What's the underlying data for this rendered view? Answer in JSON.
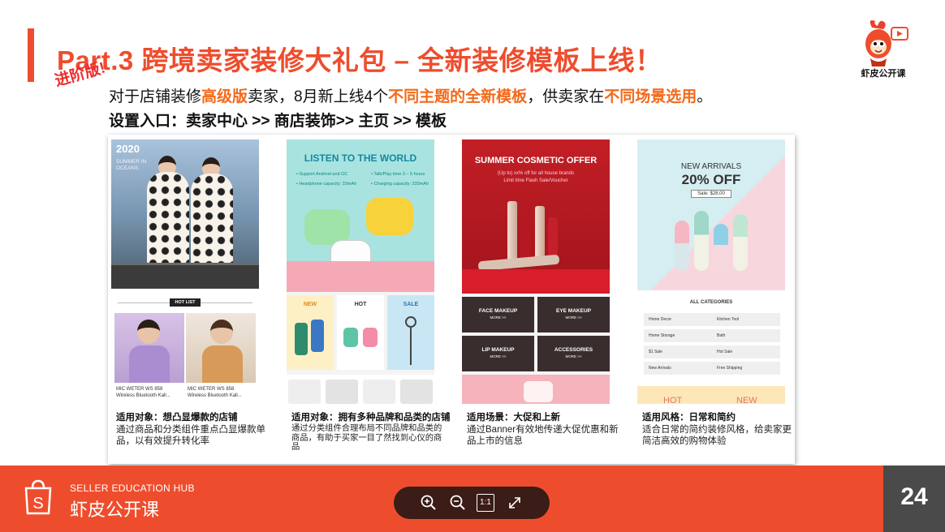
{
  "slide": {
    "title": "Part.3 跨境卖家装修大礼包 – 全新装修模板上线！",
    "stamp": "进阶版!",
    "intro": {
      "p1": "对于店铺装修",
      "h1": "高级版",
      "p2": "卖家，8月新上线4个",
      "h2": "不同主题的全新模板",
      "p3": "，供卖家在",
      "h3": "不同场景选用",
      "p4": "。"
    },
    "entry": "设置入口：卖家中心 >> 商店装饰>> 主页 >> 模板",
    "logo_label": "虾皮公开课"
  },
  "templates": [
    {
      "caption_title": "适用对象：想凸显爆款的店铺",
      "caption_desc": "通过商品和分类组件重点凸显爆款单品，以有效提升转化率",
      "shot": {
        "year": "2020",
        "subtitle": "SUMMER IN OCEANS",
        "hot_list": "HOT LIST",
        "item1": "MIC WETER WS 858\nWireless Bluetooth Kall...",
        "item2": "MIC WETER WS 858\nWireless Bluetooth Kall..."
      }
    },
    {
      "caption_title": "适用对象：拥有多种品牌和品类的店铺",
      "caption_desc": "通过分类组件合理布局不同品牌和品类的商品，有助于买家一目了然找到心仪的商品",
      "shot": {
        "heading": "LISTEN TO THE WORLD",
        "spec1": "• Support Android and OC",
        "spec2": "• Talk/Play time 3 – 5 hours",
        "spec3": "• Headphone capacity: 33mAh",
        "spec4": "• Charging capacity: 333mAh",
        "tile1": "NEW",
        "tile2": "HOT",
        "tile3": "SALE"
      }
    },
    {
      "caption_title": "适用场景：大促和上新",
      "caption_desc": "通过Banner有效地传递大促优惠和新品上市的信息",
      "shot": {
        "heading": "SUMMER COSMETIC OFFER",
        "sub1": "(Up to) xx% off for all house brands",
        "sub2": "Limit time Flash Sale/Voucher",
        "cell1": "FACE MAKEUP",
        "cell2": "EYE MAKEUP",
        "cell3": "LIP MAKEUP",
        "cell4": "ACCESSORIES",
        "more": "MORE >>"
      }
    },
    {
      "caption_title": "适用风格：日常和简约",
      "caption_desc": "适合日常的简约装修风格，给卖家更简洁高效的购物体验",
      "shot": {
        "t1": "NEW ARRIVALS",
        "t2": "20% OFF",
        "t3": "Sale: $28,00",
        "categories": "ALL CATEGORIES",
        "rows": [
          "Home Decor",
          "Kitchen Tool",
          "Home Storage",
          "Bath",
          "$1 Sale",
          "Hot Sale",
          "New Arrivals",
          "Free Shipping"
        ],
        "hot": "HOT",
        "new": "NEW"
      }
    }
  ],
  "footer": {
    "hub_en": "SELLER EDUCATION HUB",
    "hub_cn": "虾皮公开课",
    "page_number": "24",
    "toolbar": {
      "zoom_in": "zoom-in-icon",
      "zoom_out": "zoom-out-icon",
      "actual_size": "1:1",
      "fullscreen": "fullscreen-icon"
    }
  },
  "colors": {
    "brand": "#ee4d2d",
    "highlight": "#f26a1b",
    "toolbar_bg": "#3b1c17",
    "page_box": "#4a4a4a"
  }
}
